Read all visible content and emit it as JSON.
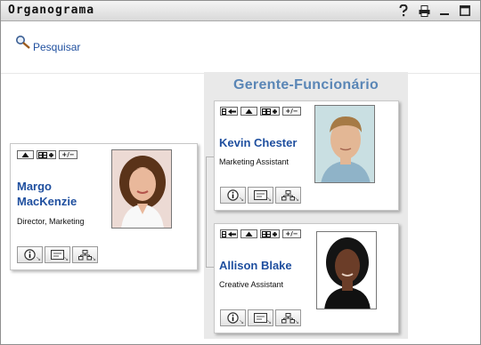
{
  "window": {
    "title": "Organograma",
    "icons": [
      "help-icon",
      "print-icon",
      "minimize-icon",
      "maximize-icon"
    ]
  },
  "toolbar": {
    "search_label": "Pesquisar",
    "search_icon": "magnifier-icon"
  },
  "group": {
    "title": "Gerente-Funcionário"
  },
  "manager": {
    "name_line1": "Margo",
    "name_line2": "MacKenzie",
    "role": "Director, Marketing",
    "top_buttons": [
      "up-arrow",
      "expand-org",
      "+/−"
    ]
  },
  "employees": [
    {
      "name": "Kevin Chester",
      "role": "Marketing Assistant",
      "top_buttons": [
        "back-arrow",
        "up-arrow",
        "expand-org",
        "+/−"
      ]
    },
    {
      "name": "Allison Blake",
      "role": "Creative Assistant",
      "top_buttons": [
        "back-arrow",
        "up-arrow",
        "expand-org",
        "+/−"
      ]
    }
  ],
  "card_actions": [
    "info-icon",
    "email-icon",
    "org-chart-icon"
  ],
  "colors": {
    "link": "#1f4f9f",
    "group_title": "#5a86b6",
    "group_bg": "#e9e9e9"
  }
}
